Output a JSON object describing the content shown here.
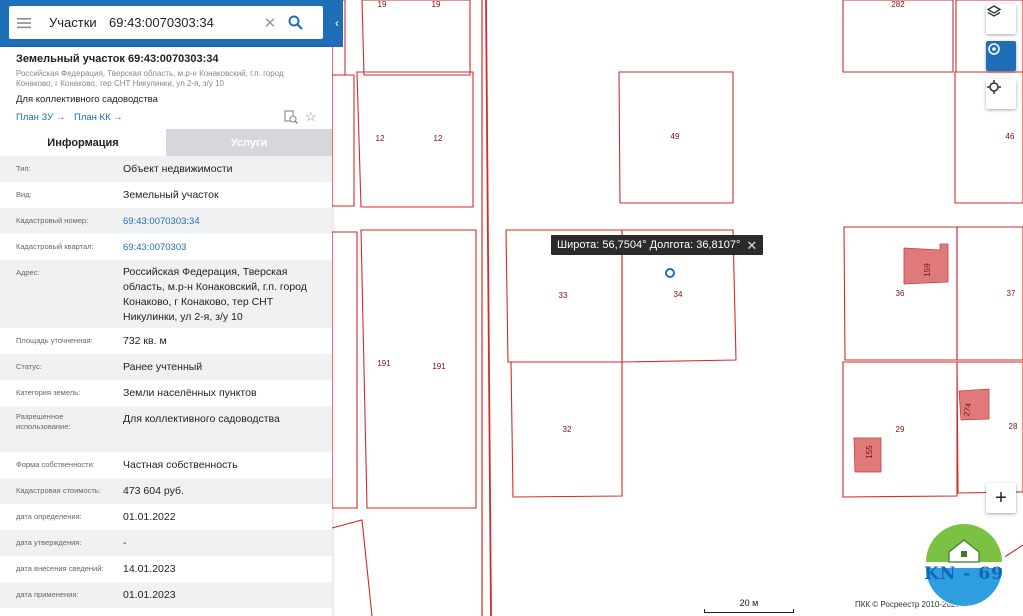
{
  "search": {
    "layer": "Участки",
    "query": "69:43:0070303:34"
  },
  "object": {
    "title": "Земельный участок 69:43:0070303:34",
    "region": "Российская Федерация, Тверская область, м.р-н Конаковский, г.п. город Конаково, г Конаково, тер СНТ Никулинки, ул 2-я, з/у 10",
    "type": "Для коллективного садоводства",
    "plan_zu": "План ЗУ",
    "plan_kk": "План КК"
  },
  "tabs": [
    "Информация",
    "Услуги"
  ],
  "info": [
    {
      "label": "Тип:",
      "value": "Объект недвижимости"
    },
    {
      "label": "Вид:",
      "value": "Земельный участок"
    },
    {
      "label": "Кадастровый номер:",
      "value": "69:43:0070303:34",
      "link": true
    },
    {
      "label": "Кадастровый квартал:",
      "value": "69:43:0070303",
      "link": true
    },
    {
      "label": "Адрес:",
      "value": "Российская Федерация, Тверская область, м.р-н Конаковский, г.п. город Конаково, г Конаково, тер СНТ Никулинки, ул 2-я, з/у 10"
    },
    {
      "label": "Площадь уточненная:",
      "value": "732 кв. м"
    },
    {
      "label": "Статус:",
      "value": "Ранее учтенный"
    },
    {
      "label": "Категория земель:",
      "value": "Земли населённых пунктов"
    },
    {
      "label": "Разрешенное использование:",
      "value": "Для коллективного садоводства"
    },
    {
      "label": "Форма собственности:",
      "value": "Частная собственность"
    },
    {
      "label": "Кадастровая стоимость:",
      "value": "473 604 руб."
    },
    {
      "label": "дата определения:",
      "value": "01.01.2022"
    },
    {
      "label": "дата утверждения:",
      "value": "-"
    },
    {
      "label": "дата внесения сведений:",
      "value": "14.01.2023"
    },
    {
      "label": "дата применения:",
      "value": "01.01.2023"
    }
  ],
  "map": {
    "coord_popup": "Широта: 56,7504° Долгота: 36,8107°",
    "scale_label": "20 м",
    "copyright": "ПКК © Росреестр 2010-2023",
    "plot_labels": [
      "19",
      "19",
      "282",
      "12",
      "12",
      "49",
      "46",
      "33",
      "34",
      "36",
      "37",
      "191",
      "191",
      "32",
      "29",
      "28"
    ],
    "building_labels": [
      "159",
      "274",
      "155"
    ],
    "zoom_in": "+",
    "logo_text": "KN - 69",
    "colors": {
      "accent": "#1e6fb8",
      "parcel": "#d42a2a",
      "building": "#e07a7a"
    }
  }
}
